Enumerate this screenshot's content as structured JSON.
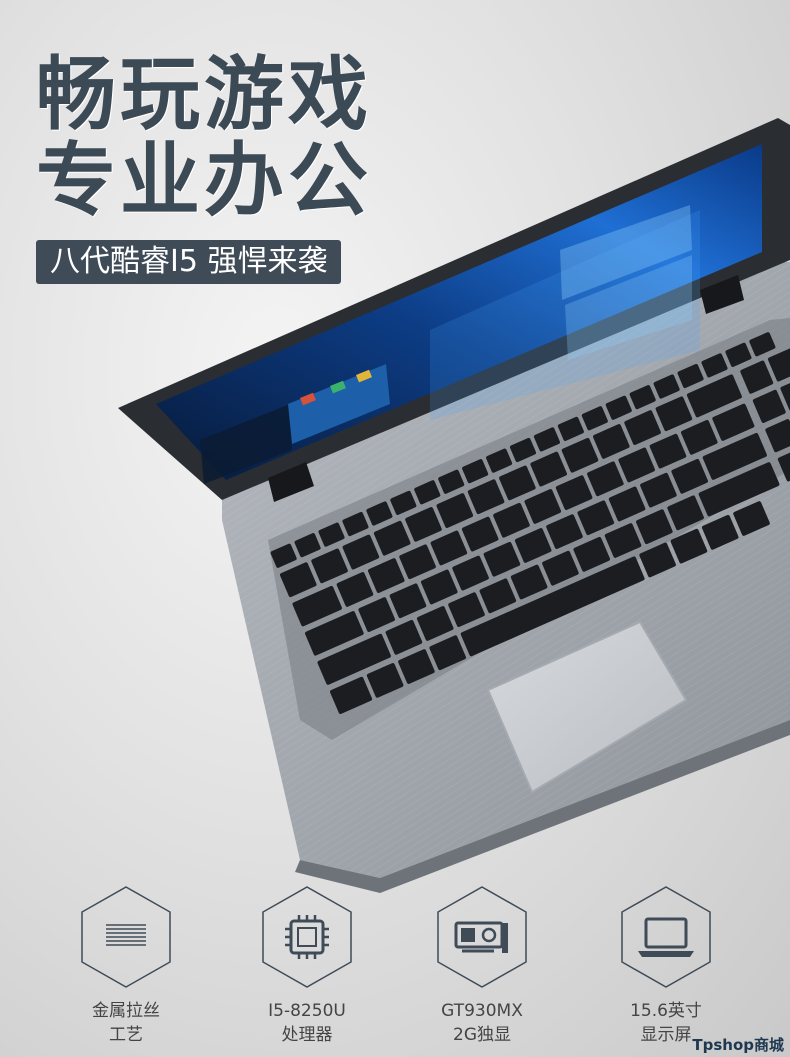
{
  "headline": {
    "line1": "畅玩游戏",
    "line2": "专业办公"
  },
  "tagline": "八代酷睿I5 强悍来袭",
  "features": [
    {
      "icon": "brushed-metal-icon",
      "label1": "金属拉丝",
      "label2": "工艺"
    },
    {
      "icon": "cpu-chip-icon",
      "label1": "I5-8250U",
      "label2": "处理器"
    },
    {
      "icon": "graphics-card-icon",
      "label1": "GT930MX",
      "label2": "2G独显"
    },
    {
      "icon": "laptop-screen-icon",
      "label1": "15.6英寸",
      "label2": "显示屏"
    }
  ],
  "footer": {
    "watermark": "Tpshop商城"
  },
  "colors": {
    "accent": "#3f4b56",
    "screen_blue": "#1a6fd1",
    "laptop_body": "#9ea3aa"
  }
}
